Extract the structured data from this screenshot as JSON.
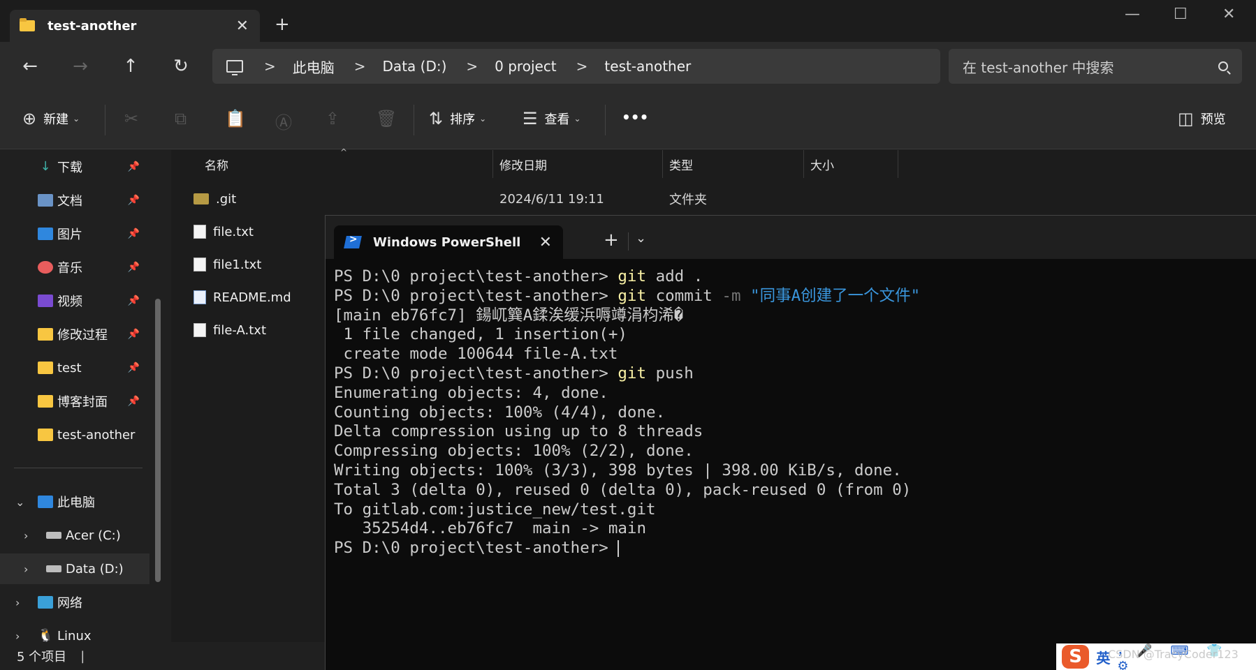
{
  "explorer": {
    "tab_title": "test-another",
    "tab_close": "✕",
    "new_tab": "+",
    "window_controls": {
      "minimize": "—",
      "maximize": "☐",
      "close": "✕"
    },
    "nav": {
      "back": "←",
      "forward": "→",
      "up": "↑",
      "refresh": "↻"
    },
    "breadcrumb": [
      "此电脑",
      "Data (D:)",
      "0 project",
      "test-another"
    ],
    "breadcrumb_sep": ">",
    "search_placeholder": "在 test-another 中搜索",
    "toolbar": {
      "new_label": "新建",
      "sort_label": "排序",
      "view_label": "查看",
      "more_label": "•••",
      "preview_label": "预览"
    },
    "sidebar": {
      "quick": [
        {
          "label": "下载",
          "icon": "download-icon",
          "pinned": true
        },
        {
          "label": "文档",
          "icon": "documents-icon",
          "pinned": true
        },
        {
          "label": "图片",
          "icon": "pictures-icon",
          "pinned": true
        },
        {
          "label": "音乐",
          "icon": "music-icon",
          "pinned": true
        },
        {
          "label": "视频",
          "icon": "video-icon",
          "pinned": true
        },
        {
          "label": "修改过程",
          "icon": "folder-icon",
          "pinned": true
        },
        {
          "label": "test",
          "icon": "folder-icon",
          "pinned": true
        },
        {
          "label": "博客封面",
          "icon": "folder-icon",
          "pinned": true
        },
        {
          "label": "test-another",
          "icon": "folder-icon",
          "pinned": false
        }
      ],
      "this_pc": "此电脑",
      "drives": [
        {
          "label": "Acer (C:)",
          "selected": false
        },
        {
          "label": "Data (D:)",
          "selected": true
        }
      ],
      "network": "网络",
      "linux": "Linux"
    },
    "columns": [
      "名称",
      "修改日期",
      "类型",
      "大小"
    ],
    "files": [
      {
        "name": ".git",
        "kind": "folder",
        "date": "2024/6/11 19:11",
        "type": "文件夹"
      },
      {
        "name": "file.txt",
        "kind": "txt",
        "date": "",
        "type": ""
      },
      {
        "name": "file1.txt",
        "kind": "txt",
        "date": "",
        "type": ""
      },
      {
        "name": "README.md",
        "kind": "md",
        "date": "",
        "type": ""
      },
      {
        "name": "file-A.txt",
        "kind": "txt",
        "date": "",
        "type": ""
      }
    ],
    "status": "5 个项目"
  },
  "powershell": {
    "tab_title": "Windows PowerShell",
    "tab_close": "✕",
    "new_tab": "+",
    "dropdown": "⌄",
    "lines": [
      [
        {
          "t": "PS D:\\0 project\\test-another> ",
          "c": ""
        },
        {
          "t": "git",
          "c": "t-yellow"
        },
        {
          "t": " add .",
          "c": ""
        }
      ],
      [
        {
          "t": "PS D:\\0 project\\test-another> ",
          "c": ""
        },
        {
          "t": "git",
          "c": "t-yellow"
        },
        {
          "t": " commit ",
          "c": ""
        },
        {
          "t": "-m",
          "c": "t-gray"
        },
        {
          "t": " \"同事A创建了一个文件\"",
          "c": "t-blue"
        }
      ],
      [
        {
          "t": "[main eb76fc7] 鍚屼簨A鍒涘缓浜嗕竴涓枃浠�",
          "c": ""
        }
      ],
      [
        {
          "t": " 1 file changed, 1 insertion(+)",
          "c": ""
        }
      ],
      [
        {
          "t": " create mode 100644 file-A.txt",
          "c": ""
        }
      ],
      [
        {
          "t": "PS D:\\0 project\\test-another> ",
          "c": ""
        },
        {
          "t": "git",
          "c": "t-yellow"
        },
        {
          "t": " push",
          "c": ""
        }
      ],
      [
        {
          "t": "Enumerating objects: 4, done.",
          "c": ""
        }
      ],
      [
        {
          "t": "Counting objects: 100% (4/4), done.",
          "c": ""
        }
      ],
      [
        {
          "t": "Delta compression using up to 8 threads",
          "c": ""
        }
      ],
      [
        {
          "t": "Compressing objects: 100% (2/2), done.",
          "c": ""
        }
      ],
      [
        {
          "t": "Writing objects: 100% (3/3), 398 bytes | 398.00 KiB/s, done.",
          "c": ""
        }
      ],
      [
        {
          "t": "Total 3 (delta 0), reused 0 (delta 0), pack-reused 0 (from 0)",
          "c": ""
        }
      ],
      [
        {
          "t": "To gitlab.com:justice_new/test.git",
          "c": ""
        }
      ],
      [
        {
          "t": "   35254d4..eb76fc7  main -> main",
          "c": ""
        }
      ],
      [
        {
          "t": "PS D:\\0 project\\test-another> ",
          "c": ""
        }
      ]
    ]
  },
  "ime": {
    "logo": "S",
    "mode": "英",
    "icons": "，🎤 ⌨ 👕 ⚙"
  },
  "watermark": "CSDN @TracyCoder123"
}
